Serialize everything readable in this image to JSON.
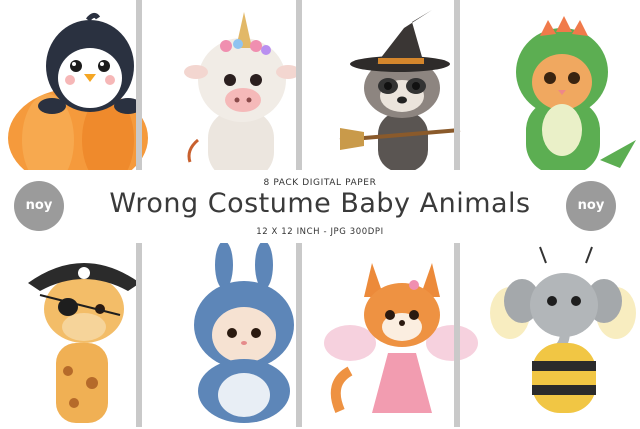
{
  "header": {
    "pack_label": "8 PACK DIGITAL PAPER",
    "title": "Wrong Costume Baby Animals",
    "specs": "12 X 12 INCH - JPG 300DPI"
  },
  "logo": {
    "text": "noy"
  },
  "colors": {
    "divider": "#c9c9c9",
    "logo_bg": "#9b9b9b",
    "title_text": "#3a3a3a"
  },
  "panels": [
    {
      "name": "penguin-in-pumpkin"
    },
    {
      "name": "cow-unicorn"
    },
    {
      "name": "raccoon-witch"
    },
    {
      "name": "cat-dinosaur"
    },
    {
      "name": "giraffe-pirate"
    },
    {
      "name": "bunny-shark"
    },
    {
      "name": "fox-fairy"
    },
    {
      "name": "elephant-bee"
    }
  ]
}
